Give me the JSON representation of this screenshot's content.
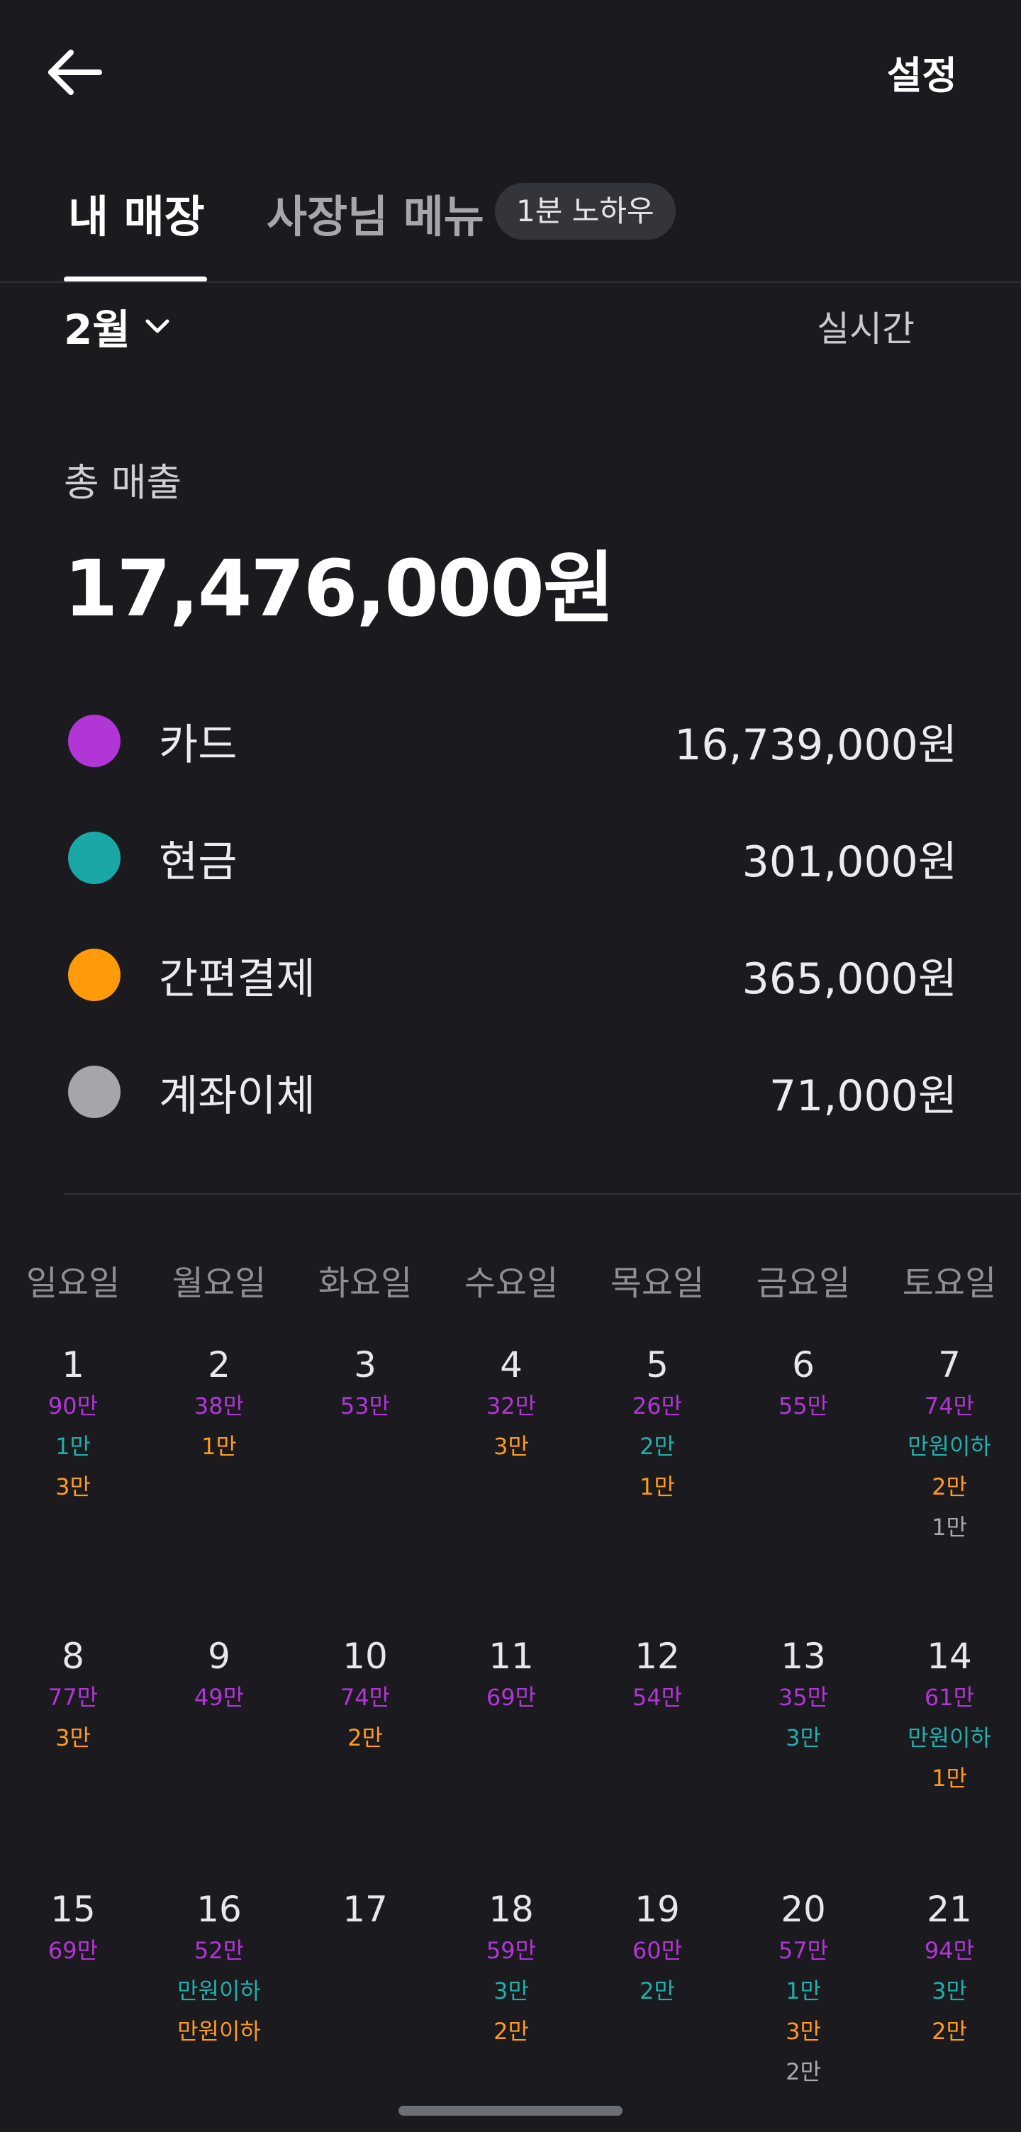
{
  "header": {
    "settings_label": "설정"
  },
  "tabs": [
    {
      "label": "내 매장",
      "active": true
    },
    {
      "label": "사장님 메뉴",
      "badge": "1분 노하우"
    }
  ],
  "period": {
    "month_label": "2월",
    "realtime_label": "실시간"
  },
  "summary": {
    "total_label": "총 매출",
    "total_value": "17,476,000원"
  },
  "payments": [
    {
      "label": "카드",
      "amount": "16,739,000원",
      "color": "#b235d6"
    },
    {
      "label": "현금",
      "amount": "301,000원",
      "color": "#1aa8a6"
    },
    {
      "label": "간편결제",
      "amount": "365,000원",
      "color": "#ff9a0a"
    },
    {
      "label": "계좌이체",
      "amount": "71,000원",
      "color": "#a5a5ac"
    }
  ],
  "calendar": {
    "weekdays": [
      "일요일",
      "월요일",
      "화요일",
      "수요일",
      "목요일",
      "금요일",
      "토요일"
    ],
    "weeks": [
      [
        {
          "day": "1",
          "card": "90만",
          "cash": "1만",
          "easy": "3만",
          "bank": ""
        },
        {
          "day": "2",
          "card": "38만",
          "cash": "",
          "easy": "1만",
          "bank": ""
        },
        {
          "day": "3",
          "card": "53만",
          "cash": "",
          "easy": "",
          "bank": ""
        },
        {
          "day": "4",
          "card": "32만",
          "cash": "",
          "easy": "3만",
          "bank": ""
        },
        {
          "day": "5",
          "card": "26만",
          "cash": "2만",
          "easy": "1만",
          "bank": ""
        },
        {
          "day": "6",
          "card": "55만",
          "cash": "",
          "easy": "",
          "bank": ""
        },
        {
          "day": "7",
          "card": "74만",
          "cash": "만원이하",
          "easy": "2만",
          "bank": "1만"
        }
      ],
      [
        {
          "day": "8",
          "card": "77만",
          "cash": "",
          "easy": "3만",
          "bank": ""
        },
        {
          "day": "9",
          "card": "49만",
          "cash": "",
          "easy": "",
          "bank": ""
        },
        {
          "day": "10",
          "card": "74만",
          "cash": "",
          "easy": "2만",
          "bank": ""
        },
        {
          "day": "11",
          "card": "69만",
          "cash": "",
          "easy": "",
          "bank": ""
        },
        {
          "day": "12",
          "card": "54만",
          "cash": "",
          "easy": "",
          "bank": ""
        },
        {
          "day": "13",
          "card": "35만",
          "cash": "3만",
          "easy": "",
          "bank": ""
        },
        {
          "day": "14",
          "card": "61만",
          "cash": "만원이하",
          "easy": "1만",
          "bank": ""
        }
      ],
      [
        {
          "day": "15",
          "card": "69만",
          "cash": "",
          "easy": "",
          "bank": ""
        },
        {
          "day": "16",
          "card": "52만",
          "cash": "만원이하",
          "easy": "만원이하",
          "bank": ""
        },
        {
          "day": "17",
          "card": "",
          "cash": "",
          "easy": "",
          "bank": ""
        },
        {
          "day": "18",
          "card": "59만",
          "cash": "3만",
          "easy": "2만",
          "bank": ""
        },
        {
          "day": "19",
          "card": "60만",
          "cash": "2만",
          "easy": "",
          "bank": ""
        },
        {
          "day": "20",
          "card": "57만",
          "cash": "1만",
          "easy": "3만",
          "bank": "2만"
        },
        {
          "day": "21",
          "card": "94만",
          "cash": "3만",
          "easy": "2만",
          "bank": ""
        }
      ]
    ]
  }
}
